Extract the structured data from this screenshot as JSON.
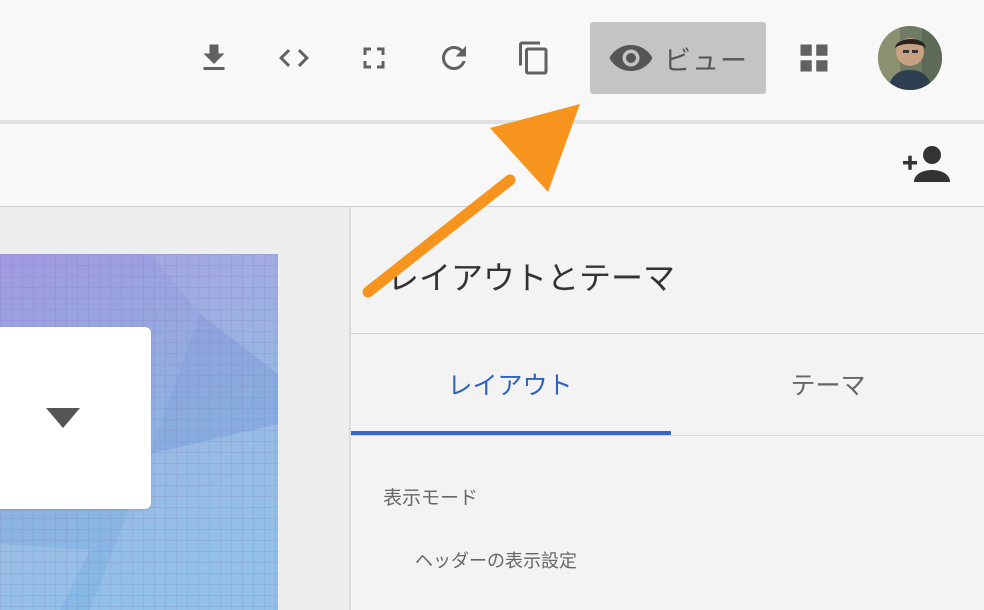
{
  "toolbar": {
    "icons": [
      "download-icon",
      "code-embed-icon",
      "fullscreen-icon",
      "refresh-icon",
      "copy-icon",
      "apps-grid-icon"
    ],
    "view_button_label": "ビュー"
  },
  "subbar": {
    "icons": [
      "add-person-icon"
    ]
  },
  "panel": {
    "title": "レイアウトとテーマ",
    "tabs": [
      {
        "label": "レイアウト",
        "active": true
      },
      {
        "label": "テーマ",
        "active": false
      }
    ],
    "section_label": "表示モード",
    "sub_label": "ヘッダーの表示設定"
  },
  "colors": {
    "accent_blue": "#3766c8",
    "annotation_arrow": "#f7941d",
    "view_button_bg": "#c4c4c4"
  }
}
